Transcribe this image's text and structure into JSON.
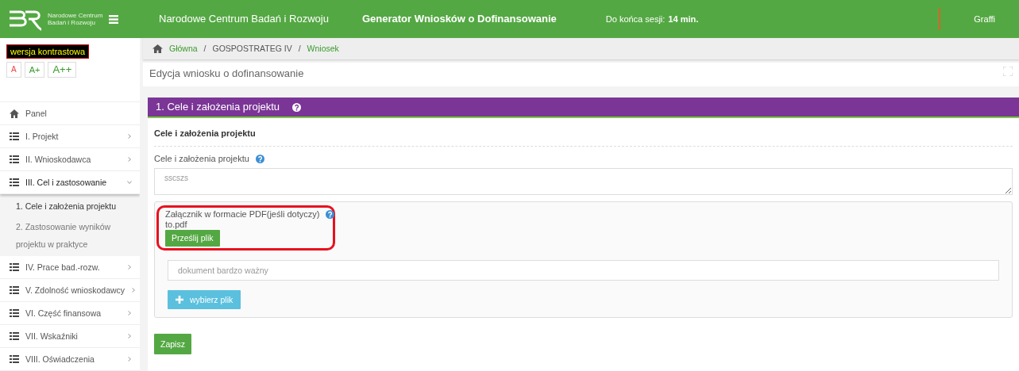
{
  "header": {
    "logo_text": [
      "Narodowe Centrum",
      "Badań i Rozwoju"
    ],
    "title": "Narodowe Centrum Badań i Rozwoju",
    "app_title": "Generator Wniosków o Dofinansowanie",
    "session_label": "Do końca sesji:",
    "session_time": "14 min.",
    "user": "Graffi"
  },
  "accessibility": {
    "contrast_button": "wersja kontrastowa",
    "font_sizes": [
      {
        "label": "A",
        "selected": true
      },
      {
        "label": "A+",
        "selected": false
      },
      {
        "label": "A++",
        "selected": false
      }
    ]
  },
  "sidebar": {
    "items": [
      {
        "kind": "home",
        "label": "Panel",
        "selected": false
      },
      {
        "kind": "section",
        "label": "I. Projekt",
        "expanded": false,
        "selected": false
      },
      {
        "kind": "section",
        "label": "II. Wnioskodawca",
        "expanded": false,
        "selected": false
      },
      {
        "kind": "section",
        "label": "III. Cel i zastosowanie",
        "expanded": true,
        "selected": true,
        "children": [
          {
            "label": "1. Cele i założenia projektu",
            "selected": true
          },
          {
            "label": "2. Zastosowanie wyników projektu w praktyce",
            "selected": false
          }
        ]
      },
      {
        "kind": "section",
        "label": "IV. Prace bad.-rozw.",
        "expanded": false,
        "selected": false
      },
      {
        "kind": "section",
        "label": "V. Zdolność wnioskodawcy",
        "expanded": false,
        "selected": false
      },
      {
        "kind": "section",
        "label": "VI. Część finansowa",
        "expanded": false,
        "selected": false
      },
      {
        "kind": "section",
        "label": "VII. Wskaźniki",
        "expanded": false,
        "selected": false
      },
      {
        "kind": "section",
        "label": "VIII. Oświadczenia",
        "expanded": false,
        "selected": false
      }
    ]
  },
  "breadcrumb": [
    {
      "label": "Główna",
      "kind": "link"
    },
    {
      "separator": "/",
      "label": "GOSPOSTRATEG IV",
      "kind": "text"
    },
    {
      "separator": "/",
      "label": "Wniosek",
      "kind": "link"
    }
  ],
  "page_title": "Edycja wniosku o dofinansowanie",
  "section": {
    "title": "1. Cele i założenia projektu",
    "subtitle": "Cele i założenia projektu",
    "field_label": "Cele i założenia projektu",
    "field_value": "sscszs",
    "attachment": {
      "label": "Załącznik w formacie PDF(jeśli dotyczy)",
      "file": "to.pdf",
      "upload_button": "Prześlij plik",
      "highlighted": true
    },
    "description_placeholder": "dokument bardzo ważny",
    "choose_button": "wybierz plik"
  },
  "save_button": "Zapisz"
}
